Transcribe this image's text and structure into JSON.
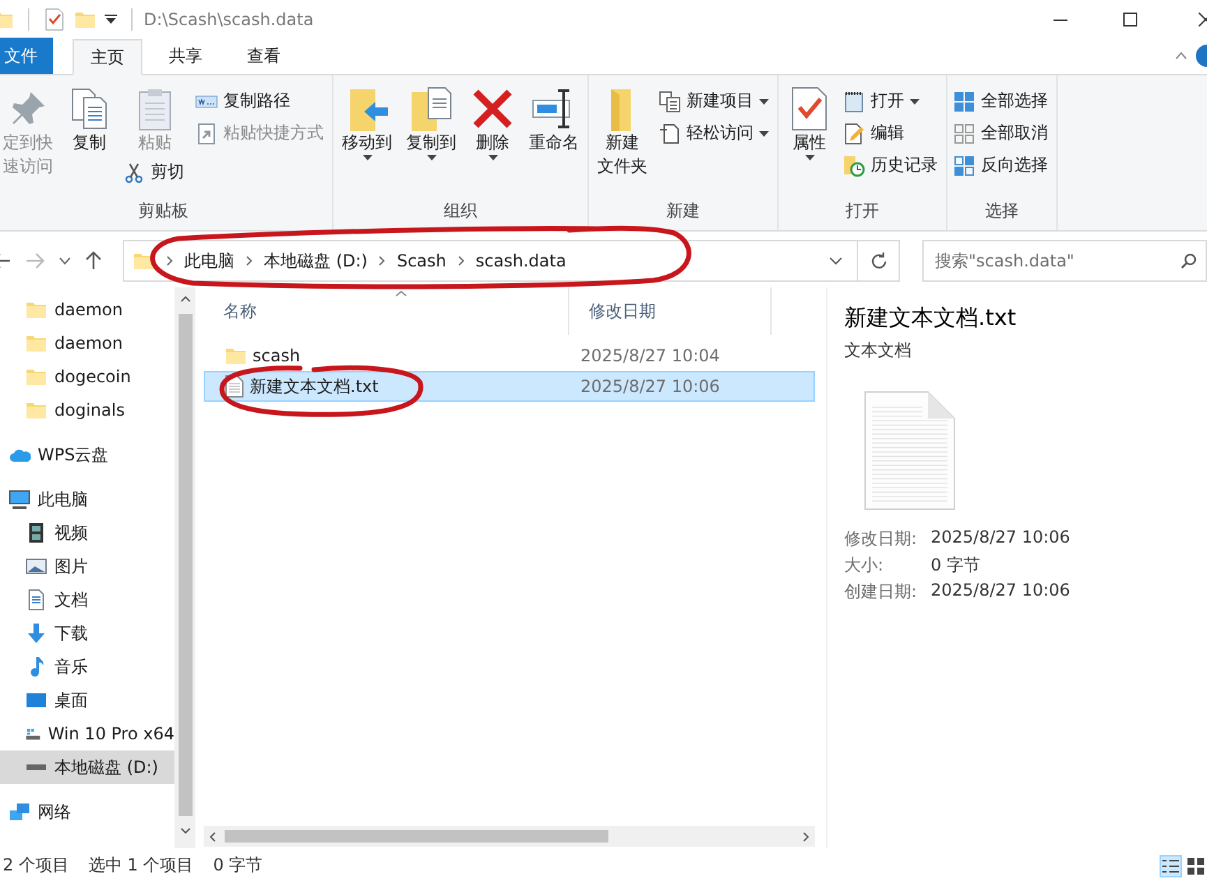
{
  "window": {
    "title": "D:\\Scash\\scash.data"
  },
  "ribbon_tabs": [
    {
      "label": "文件",
      "kind": "file",
      "selected": false
    },
    {
      "label": "主页",
      "kind": "tab",
      "selected": true
    },
    {
      "label": "共享",
      "kind": "tab",
      "selected": false
    },
    {
      "label": "查看",
      "kind": "tab",
      "selected": false
    }
  ],
  "ribbon_groups": [
    {
      "label": "剪贴板",
      "columns": [
        [
          {
            "kind": "large",
            "lines": [
              "定到快",
              "速访问"
            ],
            "dropdown": false,
            "disabled": true
          }
        ],
        [
          {
            "kind": "large",
            "lines": [
              "复制"
            ],
            "dropdown": false,
            "disabled": false
          }
        ],
        [
          {
            "kind": "large",
            "lines": [
              "粘贴"
            ],
            "dropdown": false,
            "disabled": true
          },
          {
            "kind": "small",
            "lines": [
              "剪切"
            ],
            "dropdown": false,
            "disabled": false
          }
        ],
        [
          {
            "kind": "small",
            "lines": [
              "复制路径"
            ],
            "dropdown": false,
            "disabled": false
          },
          {
            "kind": "small",
            "lines": [
              "粘贴快捷方式"
            ],
            "dropdown": false,
            "disabled": true
          }
        ]
      ]
    },
    {
      "label": "组织",
      "columns": [
        [
          {
            "kind": "large",
            "lines": [
              "移动到"
            ],
            "dropdown": true,
            "disabled": false
          }
        ],
        [
          {
            "kind": "large",
            "lines": [
              "复制到"
            ],
            "dropdown": true,
            "disabled": false
          }
        ],
        [
          {
            "kind": "large",
            "lines": [
              "删除"
            ],
            "dropdown": true,
            "disabled": false
          }
        ],
        [
          {
            "kind": "large",
            "lines": [
              "重命名"
            ],
            "dropdown": false,
            "disabled": false
          }
        ]
      ]
    },
    {
      "label": "新建",
      "columns": [
        [
          {
            "kind": "large",
            "lines": [
              "新建",
              "文件夹"
            ],
            "dropdown": false,
            "disabled": false
          }
        ],
        [
          {
            "kind": "small",
            "lines": [
              "新建项目"
            ],
            "dropdown": true,
            "disabled": false
          },
          {
            "kind": "small",
            "lines": [
              "轻松访问"
            ],
            "dropdown": true,
            "disabled": false
          }
        ]
      ]
    },
    {
      "label": "打开",
      "columns": [
        [
          {
            "kind": "large",
            "lines": [
              "属性"
            ],
            "dropdown": true,
            "disabled": false
          }
        ],
        [
          {
            "kind": "small",
            "lines": [
              "打开"
            ],
            "dropdown": true,
            "disabled": false
          },
          {
            "kind": "small",
            "lines": [
              "编辑"
            ],
            "dropdown": false,
            "disabled": false
          },
          {
            "kind": "small",
            "lines": [
              "历史记录"
            ],
            "dropdown": false,
            "disabled": false
          }
        ]
      ]
    },
    {
      "label": "选择",
      "columns": [
        [
          {
            "kind": "small",
            "lines": [
              "全部选择"
            ],
            "dropdown": false,
            "disabled": false
          },
          {
            "kind": "small",
            "lines": [
              "全部取消"
            ],
            "dropdown": false,
            "disabled": false
          },
          {
            "kind": "small",
            "lines": [
              "反向选择"
            ],
            "dropdown": false,
            "disabled": false
          }
        ]
      ]
    }
  ],
  "address": {
    "crumbs": [
      "此电脑",
      "本地磁盘 (D:)",
      "Scash",
      "scash.data"
    ]
  },
  "search": {
    "placeholder": "搜索\"scash.data\""
  },
  "nav_pane": {
    "items": [
      {
        "children": [
          {
            "label": "daemon",
            "selected": false
          },
          {
            "label": "daemon",
            "selected": false
          },
          {
            "label": "dogecoin",
            "selected": false
          },
          {
            "label": "doginals",
            "selected": false
          }
        ]
      },
      {
        "label": "WPS云盘",
        "selected": false
      },
      {
        "label": "此电脑",
        "selected": false,
        "children": [
          {
            "label": "视频",
            "selected": false
          },
          {
            "label": "图片",
            "selected": false
          },
          {
            "label": "文档",
            "selected": false
          },
          {
            "label": "下载",
            "selected": false
          },
          {
            "label": "音乐",
            "selected": false
          },
          {
            "label": "桌面",
            "selected": false
          },
          {
            "label": "Win 10 Pro x64",
            "selected": false
          },
          {
            "label": "本地磁盘 (D:)",
            "selected": true
          }
        ]
      },
      {
        "label": "网络",
        "selected": false
      }
    ]
  },
  "file_list": {
    "columns": [
      "名称",
      "修改日期"
    ],
    "rows": [
      {
        "name": "scash",
        "modified": "2025/8/27 10:04",
        "kind": "folder",
        "selected": false
      },
      {
        "name": "新建文本文档.txt",
        "modified": "2025/8/27 10:06",
        "kind": "text",
        "selected": true
      }
    ]
  },
  "details": {
    "title": "新建文本文档.txt",
    "type": "文本文档",
    "fields": [
      {
        "label": "修改日期:",
        "value": "2025/8/27 10:06"
      },
      {
        "label": "大小:",
        "value": "0 字节"
      },
      {
        "label": "创建日期:",
        "value": "2025/8/27 10:06"
      }
    ]
  },
  "status_bar": {
    "items": [
      "2 个项目",
      "选中 1 个项目",
      "0 字节"
    ],
    "view_buttons": [
      {
        "kind": "details",
        "selected": true
      },
      {
        "kind": "tiles",
        "selected": false
      }
    ]
  },
  "annotations": [
    {
      "kind": "circle"
    },
    {
      "kind": "circle"
    }
  ]
}
